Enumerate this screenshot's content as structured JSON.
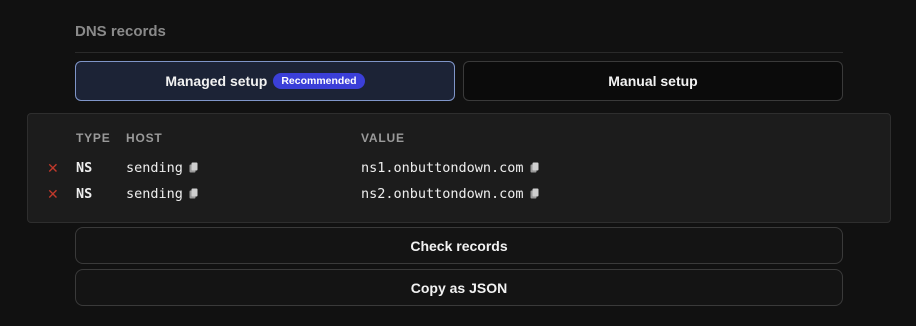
{
  "section": {
    "title": "DNS records"
  },
  "tabs": [
    {
      "label": "Managed setup",
      "badge": "Recommended",
      "active": true
    },
    {
      "label": "Manual setup",
      "active": false
    }
  ],
  "table": {
    "columns": {
      "type": "TYPE",
      "host": "HOST",
      "value": "VALUE"
    },
    "rows": [
      {
        "type": "NS",
        "host": "sending",
        "value": "ns1.onbuttondown.com",
        "status": "error"
      },
      {
        "type": "NS",
        "host": "sending",
        "value": "ns2.onbuttondown.com",
        "status": "error"
      }
    ]
  },
  "actions": {
    "check": "Check records",
    "copy_json": "Copy as JSON"
  },
  "icons": {
    "status": "x-icon",
    "copy": "copy-icon"
  },
  "colors": {
    "accent": "#3b3fd8",
    "error": "#c0392b",
    "active_border": "#7f95c8"
  }
}
